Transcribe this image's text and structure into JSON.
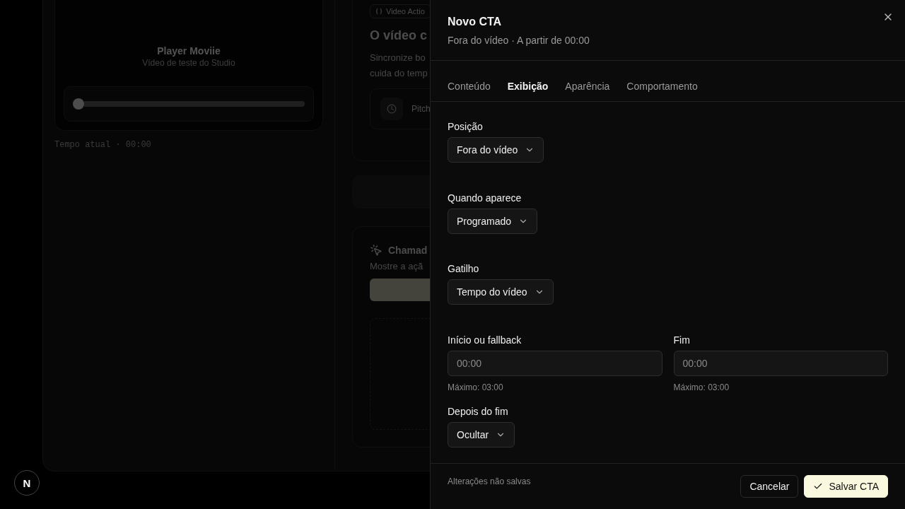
{
  "background": {
    "player": {
      "title": "Player Moviie",
      "subtitle": "Vídeo de teste do Studio",
      "level": 0
    },
    "time_label": "Tempo atual · 00:00",
    "badge": "Video Actio",
    "heading": "O vídeo c",
    "description_lines": [
      "Sincronize bo",
      "cuida do temp"
    ],
    "pitch_row": {
      "label": "Pitch"
    },
    "cta_card": {
      "title": "Chamad",
      "description": "Mostre a açã"
    },
    "logo": "N"
  },
  "drawer": {
    "title": "Novo CTA",
    "subtitle": "Fora do vídeo · A partir de 00:00",
    "tabs": [
      {
        "label": "Conteúdo",
        "selected": false
      },
      {
        "label": "Exibição",
        "selected": true
      },
      {
        "label": "Aparência",
        "selected": false
      },
      {
        "label": "Comportamento",
        "selected": false
      }
    ],
    "fields": [
      {
        "kind": "select",
        "label": "Posição",
        "value": "Fora do vídeo"
      },
      {
        "kind": "select",
        "label": "Quando aparece",
        "value": "Programado"
      },
      {
        "kind": "select",
        "label": "Gatilho",
        "value": "Tempo do vídeo"
      },
      {
        "kind": "time_pair",
        "items": [
          {
            "label": "Início ou fallback",
            "placeholder": "00:00",
            "hint": "Máximo: 03:00"
          },
          {
            "label": "Fim",
            "placeholder": "00:00",
            "hint": "Máximo: 03:00"
          }
        ]
      },
      {
        "kind": "select",
        "label": "Depois do fim",
        "value": "Ocultar"
      }
    ],
    "status": "Alterações não salvas",
    "buttons": [
      {
        "kind": "secondary",
        "label": "Cancelar"
      },
      {
        "kind": "primary",
        "label": "Salvar CTA"
      }
    ]
  }
}
